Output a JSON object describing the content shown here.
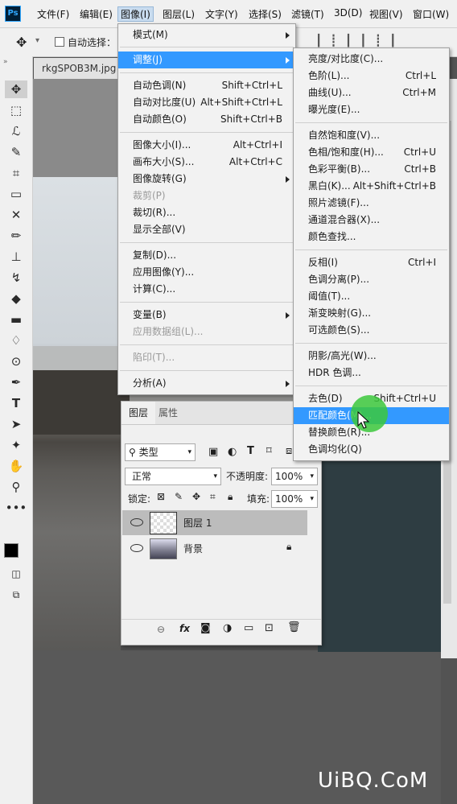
{
  "app": {
    "logo": "Ps"
  },
  "menubar": [
    {
      "label": "文件(F)"
    },
    {
      "label": "编辑(E)"
    },
    {
      "label": "图像(I)"
    },
    {
      "label": "图层(L)"
    },
    {
      "label": "文字(Y)"
    },
    {
      "label": "选择(S)"
    },
    {
      "label": "滤镜(T)"
    },
    {
      "label": "3D(D)"
    },
    {
      "label": "视图(V)"
    },
    {
      "label": "窗口(W)"
    }
  ],
  "options": {
    "auto_select_label": "自动选择："
  },
  "document": {
    "tab_title": "rkgSPOB3M.jpg @"
  },
  "image_menu": {
    "items": [
      {
        "label": "模式(M)",
        "shortcut": "",
        "submenu": true
      },
      {
        "label": "调整(J)",
        "shortcut": "",
        "submenu": true,
        "highlighted": true
      },
      {
        "label": "自动色调(N)",
        "shortcut": "Shift+Ctrl+L"
      },
      {
        "label": "自动对比度(U)",
        "shortcut": "Alt+Shift+Ctrl+L"
      },
      {
        "label": "自动颜色(O)",
        "shortcut": "Shift+Ctrl+B"
      },
      {
        "label": "图像大小(I)...",
        "shortcut": "Alt+Ctrl+I"
      },
      {
        "label": "画布大小(S)...",
        "shortcut": "Alt+Ctrl+C"
      },
      {
        "label": "图像旋转(G)",
        "shortcut": "",
        "submenu": true
      },
      {
        "label": "裁剪(P)",
        "shortcut": "",
        "disabled": true
      },
      {
        "label": "裁切(R)...",
        "shortcut": ""
      },
      {
        "label": "显示全部(V)",
        "shortcut": ""
      },
      {
        "label": "复制(D)...",
        "shortcut": ""
      },
      {
        "label": "应用图像(Y)...",
        "shortcut": ""
      },
      {
        "label": "计算(C)...",
        "shortcut": ""
      },
      {
        "label": "变量(B)",
        "shortcut": "",
        "submenu": true
      },
      {
        "label": "应用数据组(L)...",
        "shortcut": "",
        "disabled": true
      },
      {
        "label": "陷印(T)...",
        "shortcut": "",
        "disabled": true
      },
      {
        "label": "分析(A)",
        "shortcut": "",
        "submenu": true
      }
    ]
  },
  "adjust_menu": {
    "items": [
      {
        "label": "亮度/对比度(C)...",
        "shortcut": ""
      },
      {
        "label": "色阶(L)...",
        "shortcut": "Ctrl+L"
      },
      {
        "label": "曲线(U)...",
        "shortcut": "Ctrl+M"
      },
      {
        "label": "曝光度(E)...",
        "shortcut": ""
      },
      {
        "label": "自然饱和度(V)...",
        "shortcut": ""
      },
      {
        "label": "色相/饱和度(H)...",
        "shortcut": "Ctrl+U"
      },
      {
        "label": "色彩平衡(B)...",
        "shortcut": "Ctrl+B"
      },
      {
        "label": "黑白(K)...",
        "shortcut": "Alt+Shift+Ctrl+B"
      },
      {
        "label": "照片滤镜(F)...",
        "shortcut": ""
      },
      {
        "label": "通道混合器(X)...",
        "shortcut": ""
      },
      {
        "label": "颜色查找...",
        "shortcut": ""
      },
      {
        "label": "反相(I)",
        "shortcut": "Ctrl+I"
      },
      {
        "label": "色调分离(P)...",
        "shortcut": ""
      },
      {
        "label": "阈值(T)...",
        "shortcut": ""
      },
      {
        "label": "渐变映射(G)...",
        "shortcut": ""
      },
      {
        "label": "可选颜色(S)...",
        "shortcut": ""
      },
      {
        "label": "阴影/高光(W)...",
        "shortcut": ""
      },
      {
        "label": "HDR 色调...",
        "shortcut": ""
      },
      {
        "label": "去色(D)",
        "shortcut": "Shift+Ctrl+U"
      },
      {
        "label": "匹配颜色(M)...",
        "shortcut": "",
        "highlighted": true
      },
      {
        "label": "替换颜色(R)...",
        "shortcut": ""
      },
      {
        "label": "色调均化(Q)",
        "shortcut": ""
      }
    ]
  },
  "layers_panel": {
    "tabs": [
      "图层",
      "属性"
    ],
    "filter_label": "类型",
    "blend_mode": "正常",
    "opacity_label": "不透明度:",
    "opacity_value": "100%",
    "lock_label": "锁定:",
    "fill_label": "填充:",
    "fill_value": "100%",
    "layers": [
      {
        "name": "图层 1",
        "selected": true
      },
      {
        "name": "背景",
        "locked": true
      }
    ],
    "footer_fx": "fx"
  },
  "watermark": "UiBQ.CoM",
  "colors": {
    "highlight": "#3399ff",
    "menu_bg": "#f2f2f2",
    "cursor_circle": "#3cc83c"
  }
}
